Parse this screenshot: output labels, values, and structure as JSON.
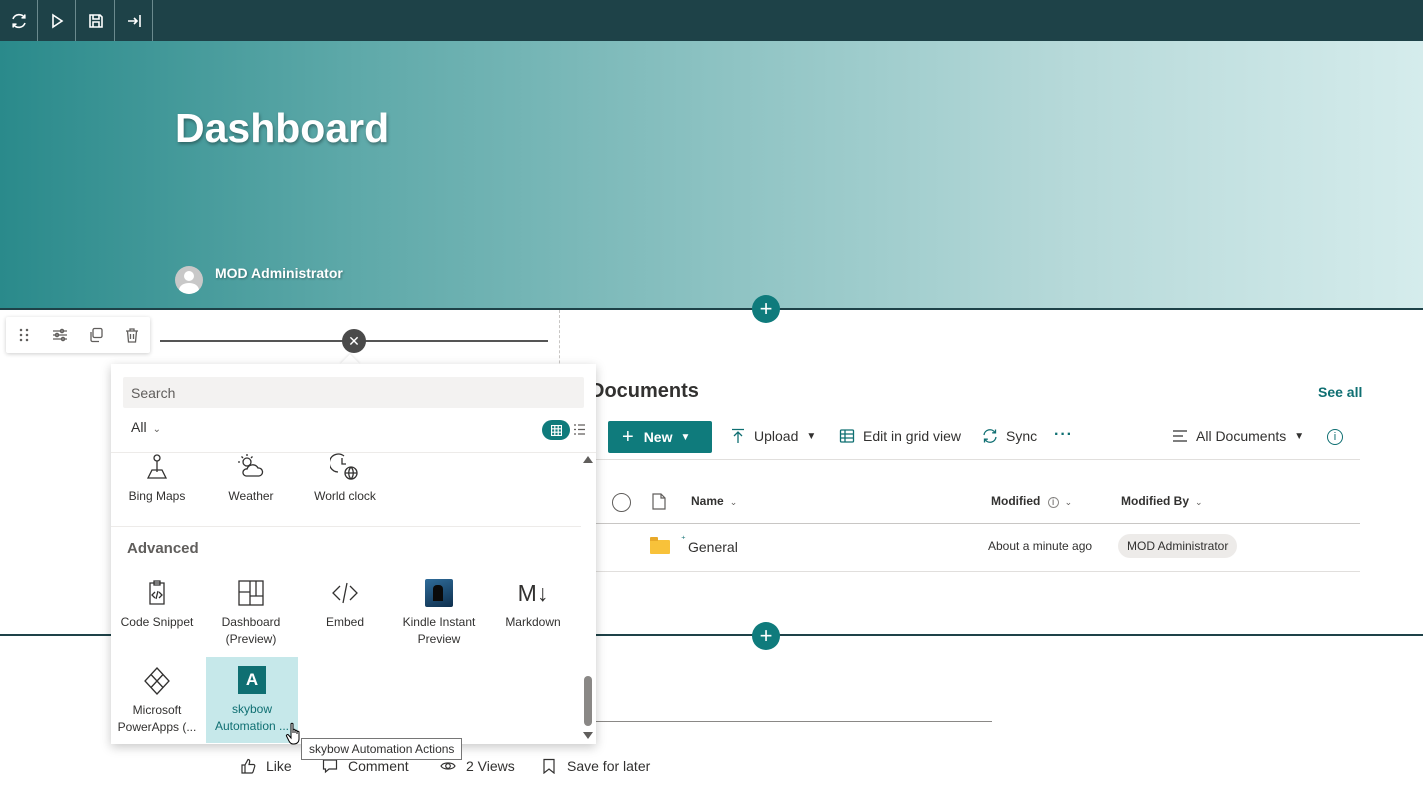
{
  "topbar": {
    "buttons": [
      {
        "name": "refresh-icon"
      },
      {
        "name": "play-icon"
      },
      {
        "name": "save-icon"
      },
      {
        "name": "exit-icon"
      }
    ]
  },
  "hero": {
    "title": "Dashboard",
    "author": "MOD Administrator"
  },
  "toolbox": {
    "search_placeholder": "Search",
    "filter": "All",
    "row_top": [
      {
        "label": "Bing Maps",
        "icon": "map-pin-icon"
      },
      {
        "label": "Weather",
        "icon": "weather-icon"
      },
      {
        "label": "World clock",
        "icon": "world-clock-icon"
      }
    ],
    "group_title": "Advanced",
    "advanced": [
      {
        "label": "Code Snippet",
        "icon": "code-snippet-icon"
      },
      {
        "label": "Dashboard (Preview)",
        "icon": "dashboard-icon"
      },
      {
        "label": "Embed",
        "icon": "embed-icon"
      },
      {
        "label": "Kindle Instant Preview",
        "icon": "kindle-icon"
      },
      {
        "label": "Markdown",
        "icon": "markdown-icon"
      },
      {
        "label": "Microsoft PowerApps (...",
        "icon": "powerapps-icon"
      },
      {
        "label": "skybow Automation ...",
        "icon": "skybow-icon",
        "selected": true
      }
    ],
    "markdown_glyph": "M↓",
    "skybow_glyph": "A",
    "tooltip": "skybow Automation Actions"
  },
  "documents": {
    "title": "Documents",
    "see_all": "See all",
    "new_label": "New",
    "commands": {
      "upload": "Upload",
      "edit_grid": "Edit in grid view",
      "sync": "Sync",
      "more": "···",
      "view": "All Documents"
    },
    "columns": {
      "name": "Name",
      "modified": "Modified",
      "modified_by": "Modified By"
    },
    "rows": [
      {
        "name": "General",
        "modified": "About a minute ago",
        "modified_by": "MOD Administrator"
      }
    ]
  },
  "social": {
    "like": "Like",
    "comment": "Comment",
    "views": "2 Views",
    "save_later": "Save for later"
  },
  "colors": {
    "topbar": "#1e4248",
    "accent": "#0f7b7c",
    "selected_tile": "#c6e8ea"
  }
}
